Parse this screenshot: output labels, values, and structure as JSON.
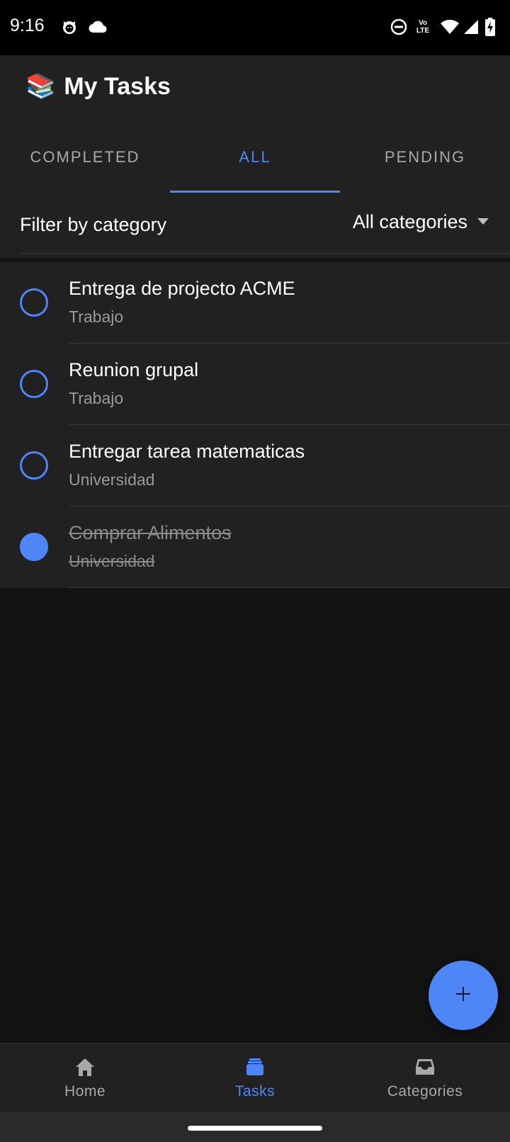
{
  "status_bar": {
    "time": "9:16",
    "network_label": "LTE",
    "volte_label": "Vo"
  },
  "app_bar": {
    "emoji": "📚",
    "title": "My Tasks"
  },
  "tabs": [
    {
      "label": "COMPLETED",
      "active": false
    },
    {
      "label": "ALL",
      "active": true
    },
    {
      "label": "PENDING",
      "active": false
    }
  ],
  "filter": {
    "label": "Filter by category",
    "selected": "All categories"
  },
  "tasks": [
    {
      "title": "Entrega de projecto ACME",
      "category": "Trabajo",
      "completed": false
    },
    {
      "title": "Reunion grupal",
      "category": "Trabajo",
      "completed": false
    },
    {
      "title": "Entregar tarea matematicas",
      "category": "Universidad",
      "completed": false
    },
    {
      "title": "Comprar Alimentos",
      "category": "Universidad",
      "completed": true
    }
  ],
  "bottom_nav": [
    {
      "label": "Home",
      "icon": "home-icon",
      "active": false
    },
    {
      "label": "Tasks",
      "icon": "stack-icon",
      "active": true
    },
    {
      "label": "Categories",
      "icon": "inbox-icon",
      "active": false
    }
  ],
  "colors": {
    "accent": "#4f86f7",
    "surface": "#212121",
    "background": "#121212"
  }
}
